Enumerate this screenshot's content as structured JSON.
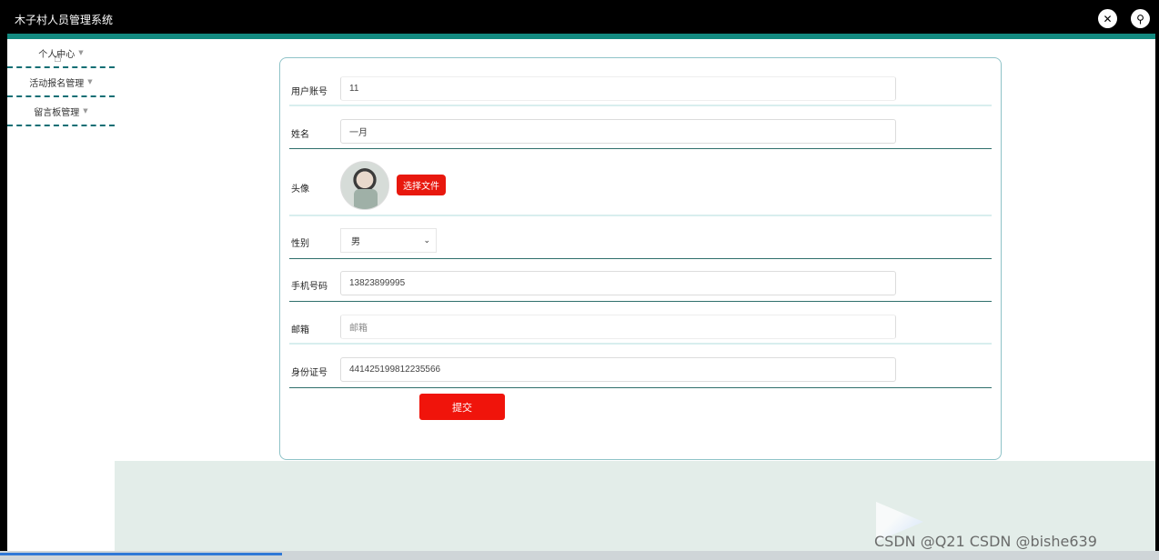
{
  "app": {
    "title": "木子村人员管理系统",
    "icons": [
      "tools-icon",
      "user-icon"
    ]
  },
  "sidebar": {
    "items": [
      {
        "label": "个人中心"
      },
      {
        "label": "活动报名管理"
      },
      {
        "label": "留言板管理"
      }
    ]
  },
  "form": {
    "fields": {
      "account": {
        "label": "用户账号",
        "value": "11"
      },
      "name": {
        "label": "姓名",
        "value": "一月"
      },
      "avatar": {
        "label": "头像",
        "button": "选择文件"
      },
      "gender": {
        "label": "性别",
        "value": "男"
      },
      "phone": {
        "label": "手机号码",
        "value": "13823899995"
      },
      "email": {
        "label": "邮箱",
        "value": "邮箱"
      },
      "idcard": {
        "label": "身份证号",
        "value": "441425199812235566"
      }
    },
    "submit": "提交"
  },
  "watermark": "CSDN @Q21 CSDN @bishe639",
  "colors": {
    "accent": "#138a80",
    "button": "#e8180e",
    "footer": "#e3ede9"
  }
}
